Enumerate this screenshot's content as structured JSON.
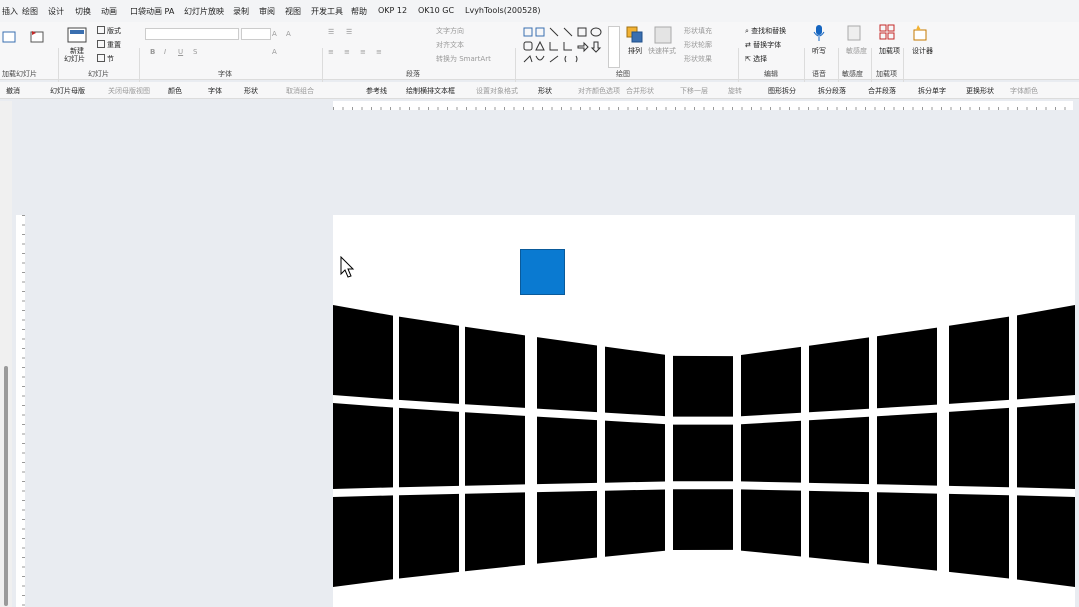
{
  "menu": {
    "items": [
      "插入",
      "绘图",
      "设计",
      "切换",
      "动画",
      "口袋动画 PA",
      "幻灯片放映",
      "录制",
      "审阅",
      "视图",
      "开发工具",
      "帮助",
      "OKP 12",
      "OK10 GC",
      "LvyhTools(200528)"
    ]
  },
  "ribbon": {
    "group_labels": [
      "幻灯片",
      "字体",
      "段落",
      "绘图",
      "编辑",
      "语音",
      "敏感度",
      "加载项"
    ],
    "left_label": "加载幻灯片",
    "buttons": {
      "new_slide_1": "新建",
      "new_slide_2": "幻灯片",
      "layout": "版式",
      "reset": "重置",
      "section": "节",
      "text_direction": "文字方向",
      "align_text": "对齐文本",
      "smartart": "转换为 SmartArt",
      "arrange": "排列",
      "quick_styles": "快速样式",
      "shape_fill": "形状填充",
      "shape_outline": "形状轮廓",
      "shape_effects": "形状效果",
      "find_replace": "查找和替换",
      "replace_font": "替换字体",
      "select": "选择",
      "dictate": "听写",
      "sensitivity": "敏感度",
      "addins": "加载项",
      "designer": "设计器"
    }
  },
  "toolbar2": {
    "items": [
      "撤消",
      "幻灯片母版",
      "关闭母版视图",
      "颜色",
      "字体",
      "形状",
      "取消组合",
      "参考线",
      "绘制横排文本框",
      "设置对象格式",
      "形状",
      "对齐颜色选项",
      "合并形状",
      "下移一层",
      "旋转",
      "图形拆分",
      "拆分段落",
      "合并段落",
      "拆分单字",
      "更换形状",
      "字体颜色"
    ]
  },
  "slide": {
    "grid_rows": 3,
    "grid_cols": 11
  }
}
